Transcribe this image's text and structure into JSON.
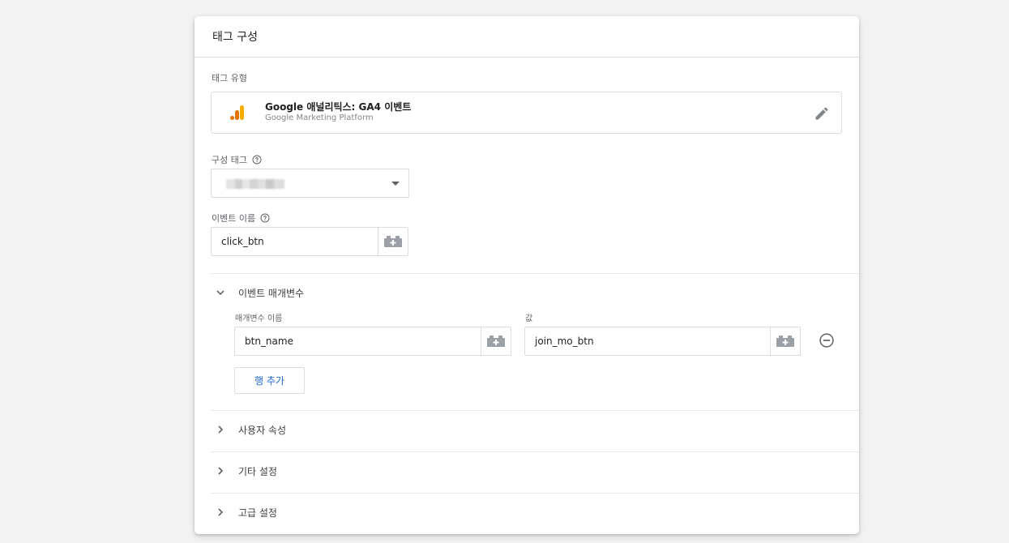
{
  "header": {
    "title": "태그 구성"
  },
  "tag_type": {
    "label": "태그 유형",
    "title": "Google 애널리틱스: GA4 이벤트",
    "subtitle": "Google Marketing Platform",
    "logo_icon": "google-analytics-icon",
    "edit_icon": "pencil-icon"
  },
  "config_tag": {
    "label": "구성 태그",
    "help_icon": "help-icon",
    "selected": ""
  },
  "event_name": {
    "label": "이벤트 이름",
    "help_icon": "help-icon",
    "value": "click_btn",
    "variable_icon": "variable-picker-icon"
  },
  "event_params": {
    "label": "이벤트 매개변수",
    "expanded": true,
    "name_col_label": "매개변수 이름",
    "value_col_label": "값",
    "rows": [
      {
        "name": "btn_name",
        "value": "join_mo_btn"
      }
    ],
    "add_row_label": "행 추가"
  },
  "sections": [
    {
      "label": "사용자 속성",
      "expanded": false
    },
    {
      "label": "기타 설정",
      "expanded": false
    },
    {
      "label": "고급 설정",
      "expanded": false
    }
  ],
  "colors": {
    "accent_blue": "#1967d2",
    "ga_orange": "#f9ab00",
    "ga_dark_orange": "#e37400",
    "border": "#dadce0",
    "background": "#f1f2f4"
  }
}
